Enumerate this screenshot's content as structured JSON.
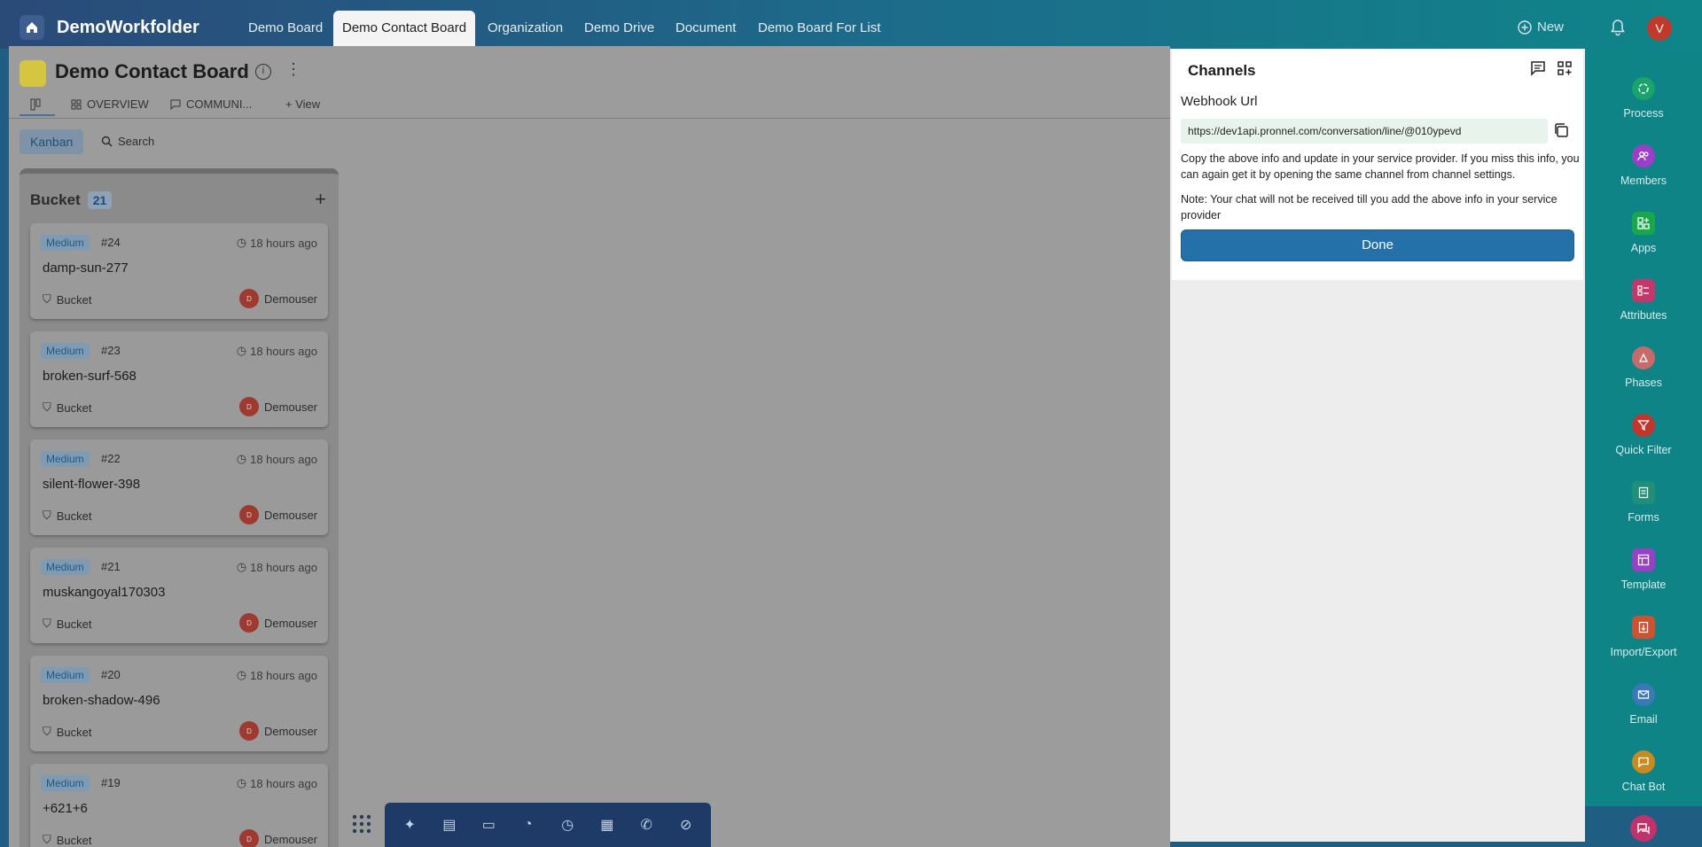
{
  "app": {
    "brand": "DemoWorkfolder"
  },
  "nav": {
    "tabs": [
      {
        "label": "Demo Board"
      },
      {
        "label": "Demo Contact Board"
      },
      {
        "label": "Organization"
      },
      {
        "label": "Demo Drive"
      },
      {
        "label": "Document"
      },
      {
        "label": "Demo Board For List"
      }
    ],
    "new_label": "New",
    "user_initial": "V"
  },
  "board": {
    "title": "Demo Contact Board",
    "info_glyph": "i",
    "subtabs": [
      {
        "label": "OVERVIEW"
      },
      {
        "label": "COMMUNI..."
      },
      {
        "label": "+ View"
      }
    ],
    "kanban_label": "Kanban",
    "search_label": "Search",
    "column": {
      "title": "Bucket",
      "count": "21"
    },
    "cards": [
      {
        "priority": "Medium",
        "num": "#24",
        "time": "18 hours ago",
        "name": "damp-sun-277",
        "bucket": "Bucket",
        "user": "Demouser",
        "user_initial": "D"
      },
      {
        "priority": "Medium",
        "num": "#23",
        "time": "18 hours ago",
        "name": "broken-surf-568",
        "bucket": "Bucket",
        "user": "Demouser",
        "user_initial": "D"
      },
      {
        "priority": "Medium",
        "num": "#22",
        "time": "18 hours ago",
        "name": "silent-flower-398",
        "bucket": "Bucket",
        "user": "Demouser",
        "user_initial": "D"
      },
      {
        "priority": "Medium",
        "num": "#21",
        "time": "18 hours ago",
        "name": "muskangoyal170303",
        "bucket": "Bucket",
        "user": "Demouser",
        "user_initial": "D"
      },
      {
        "priority": "Medium",
        "num": "#20",
        "time": "18 hours ago",
        "name": "broken-shadow-496",
        "bucket": "Bucket",
        "user": "Demouser",
        "user_initial": "D"
      },
      {
        "priority": "Medium",
        "num": "#19",
        "time": "18 hours ago",
        "name": "+621+6",
        "bucket": "Bucket",
        "user": "Demouser",
        "user_initial": "D"
      }
    ]
  },
  "channels": {
    "title": "Channels",
    "webhook_label": "Webhook Url",
    "webhook_url": "https://dev1api.pronnel.com/conversation/line/@010ypevd",
    "note1": "Copy the above info and update in your service provider. If you miss this info, you can again get it by opening the same channel from channel settings.",
    "note2": "Note: Your chat will not be received till you add the above info in your service provider",
    "done_label": "Done"
  },
  "sidebar": {
    "items": [
      {
        "label": "Process",
        "icon": "process-icon",
        "color": "#1aa36b"
      },
      {
        "label": "Members",
        "icon": "members-icon",
        "color": "#9b3fc9"
      },
      {
        "label": "Apps",
        "icon": "apps-icon",
        "color": "#17a84a"
      },
      {
        "label": "Attributes",
        "icon": "attributes-icon",
        "color": "#c2386a"
      },
      {
        "label": "Phases",
        "icon": "phases-icon",
        "color": "#c76a6a"
      },
      {
        "label": "Quick Filter",
        "icon": "filter-icon",
        "color": "#c0362c"
      },
      {
        "label": "Forms",
        "icon": "forms-icon",
        "color": "#1f8f77"
      },
      {
        "label": "Template",
        "icon": "template-icon",
        "color": "#9b3fc9"
      },
      {
        "label": "Import/Export",
        "icon": "import-export-icon",
        "color": "#d0512e"
      },
      {
        "label": "Email",
        "icon": "email-icon",
        "color": "#3a78b8"
      },
      {
        "label": "Chat Bot",
        "icon": "chat-bot-icon",
        "color": "#c98b1f"
      }
    ]
  }
}
